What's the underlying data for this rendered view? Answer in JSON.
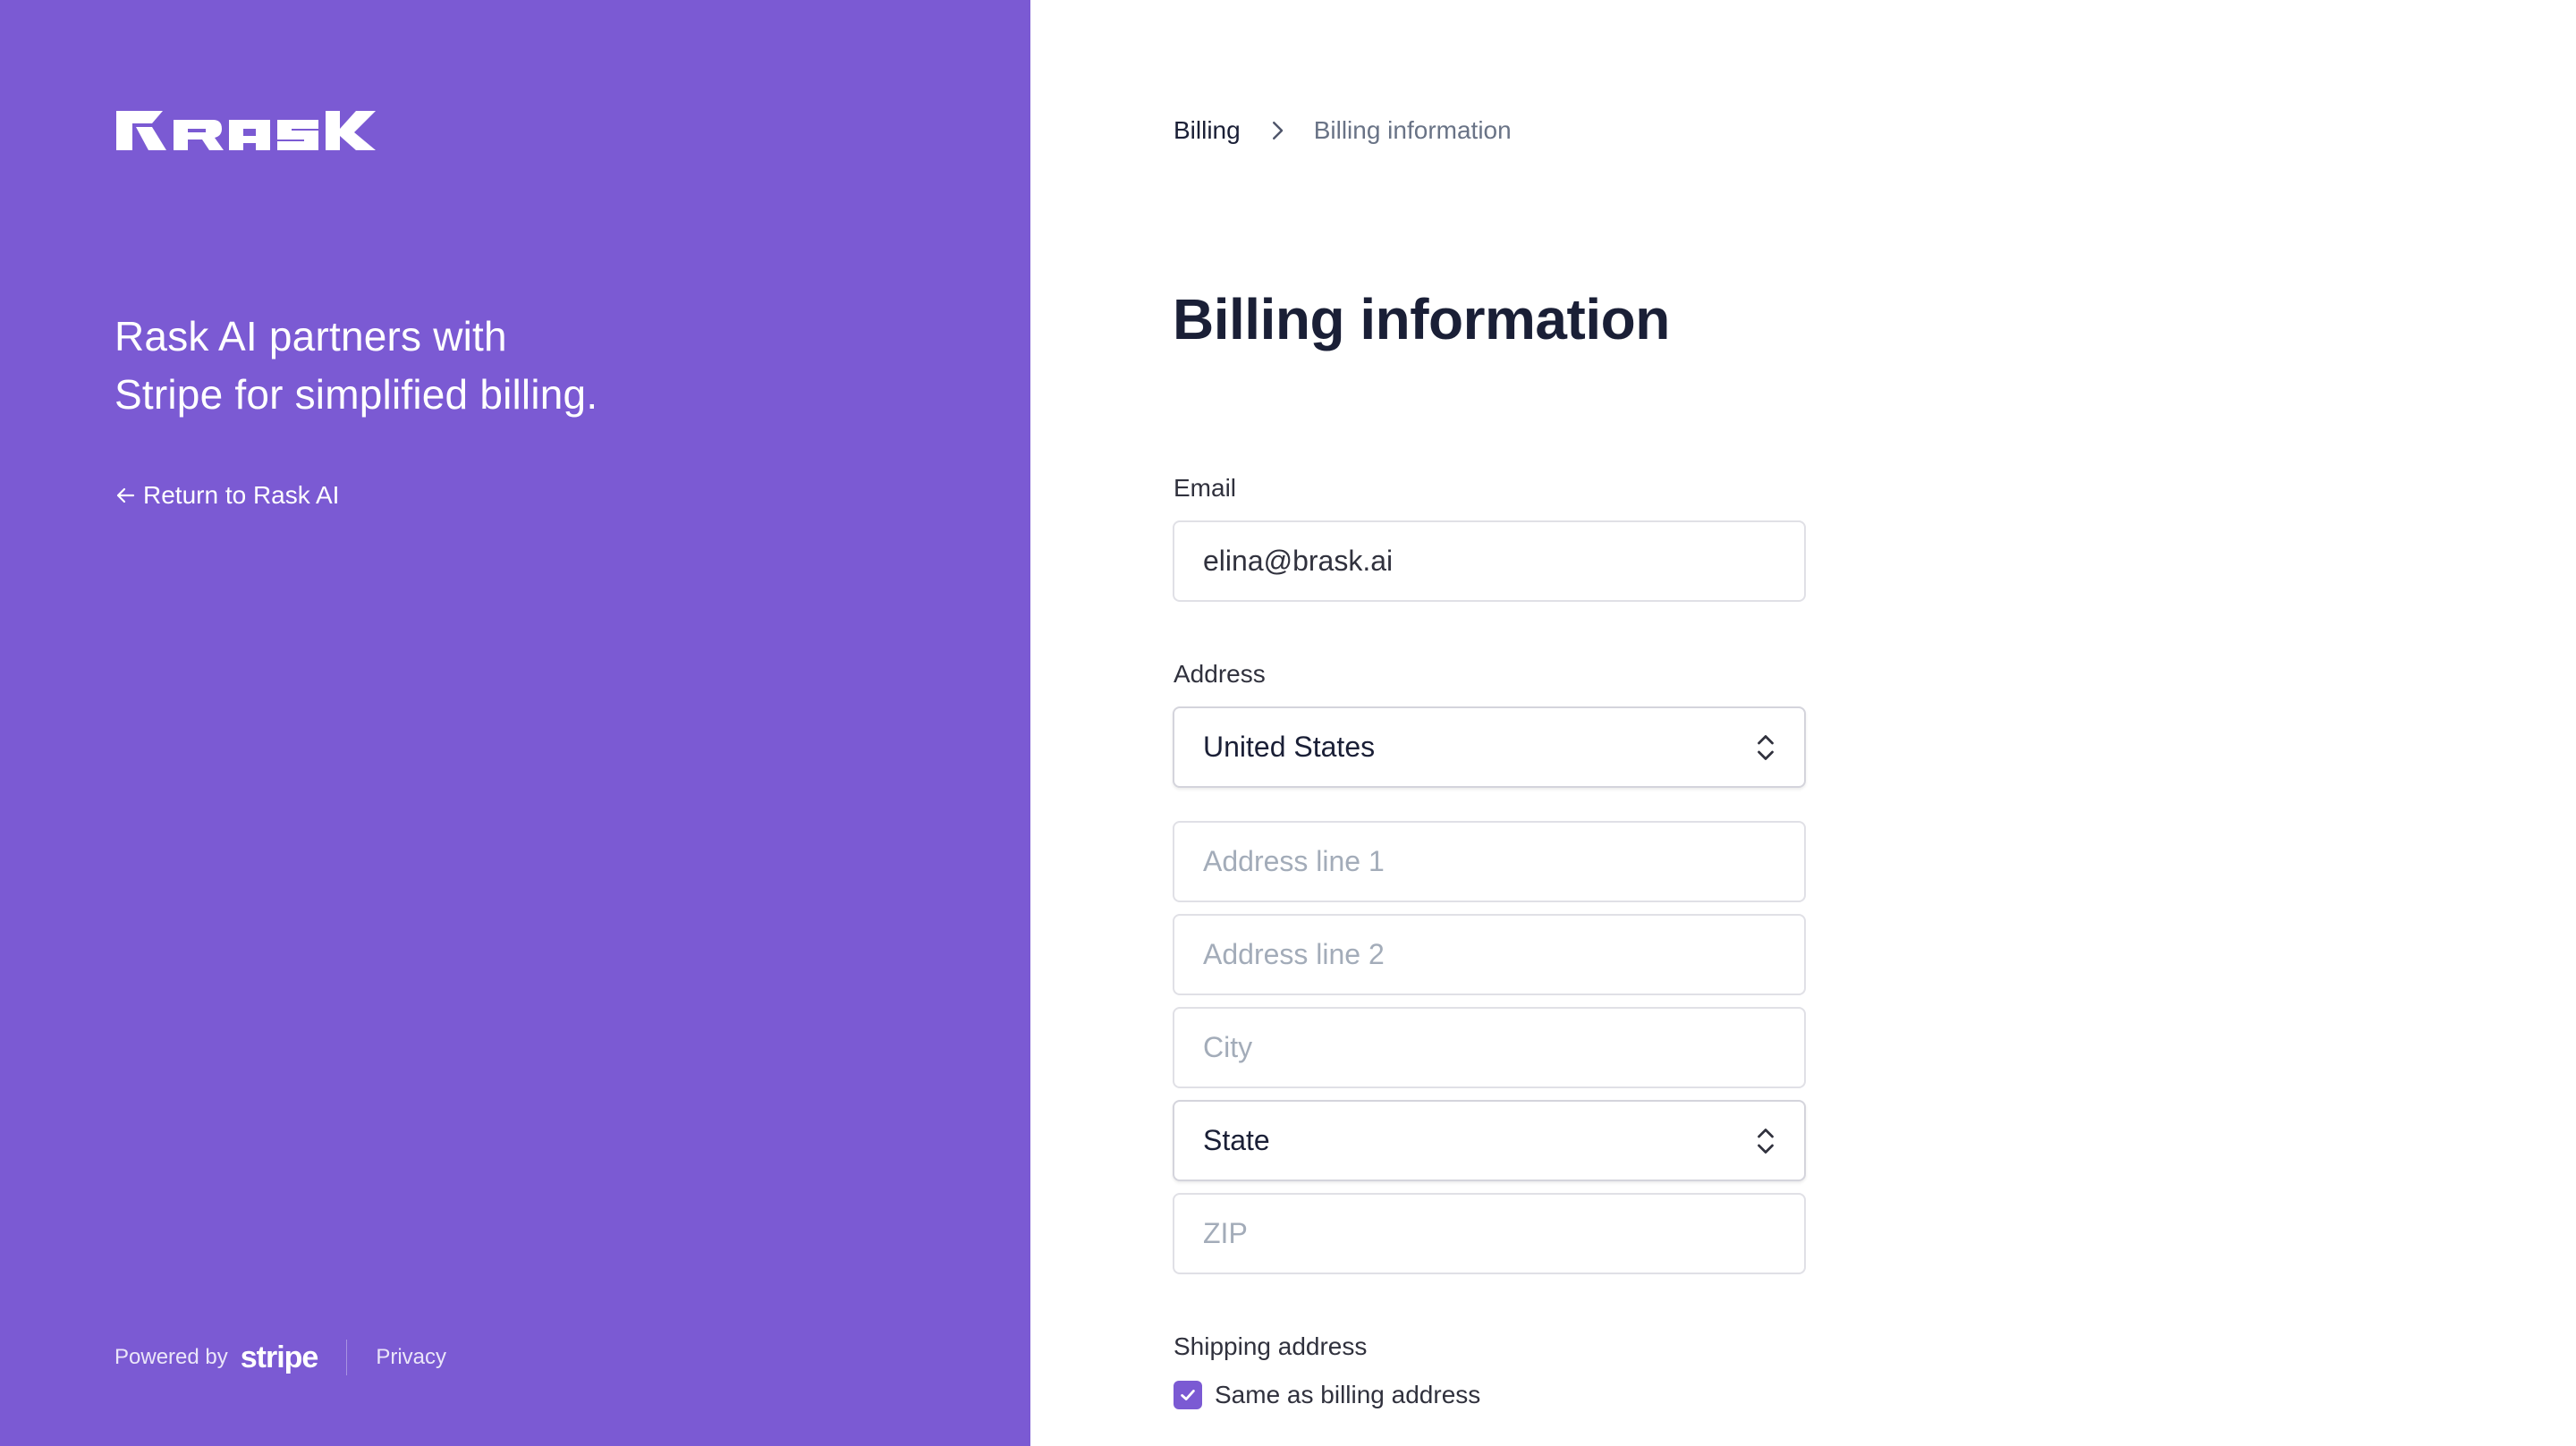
{
  "brand": {
    "logo_text": "RASK",
    "accent_color": "#7b5ad3"
  },
  "left": {
    "tagline_line1": "Rask AI partners with",
    "tagline_line2": "Stripe for simplified billing.",
    "return_link": "Return to Rask AI",
    "return_icon": "arrow-left-icon",
    "footer": {
      "powered_by": "Powered by",
      "stripe": "stripe",
      "privacy": "Privacy"
    }
  },
  "breadcrumb": {
    "item1": "Billing",
    "separator_icon": "chevron-right-icon",
    "item2": "Billing information"
  },
  "page_title": "Billing information",
  "form": {
    "email_label": "Email",
    "email_value": "elina@brask.ai",
    "address_label": "Address",
    "country_value": "United States",
    "address1_placeholder": "Address line 1",
    "address2_placeholder": "Address line 2",
    "city_placeholder": "City",
    "state_value": "State",
    "zip_placeholder": "ZIP",
    "shipping_label": "Shipping address",
    "same_as_billing": "Same as billing address",
    "same_as_billing_checked": true
  }
}
